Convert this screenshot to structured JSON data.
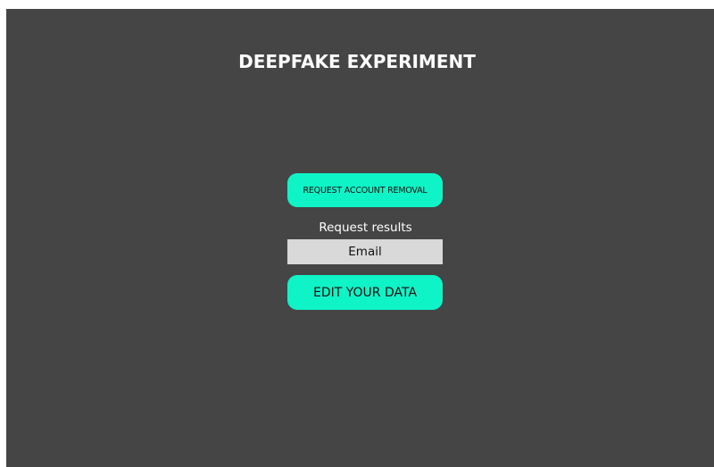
{
  "page": {
    "title": "DEEPFAKE EXPERIMENT"
  },
  "actions": {
    "request_removal_label": "REQUEST ACCOUNT REMOVAL",
    "request_results_label": "Request results",
    "email_placeholder": "Email",
    "edit_data_label": "EDIT YOUR DATA"
  },
  "colors": {
    "background": "#454545",
    "accent": "#0ef4c7",
    "input_background": "#d9d9d9"
  }
}
